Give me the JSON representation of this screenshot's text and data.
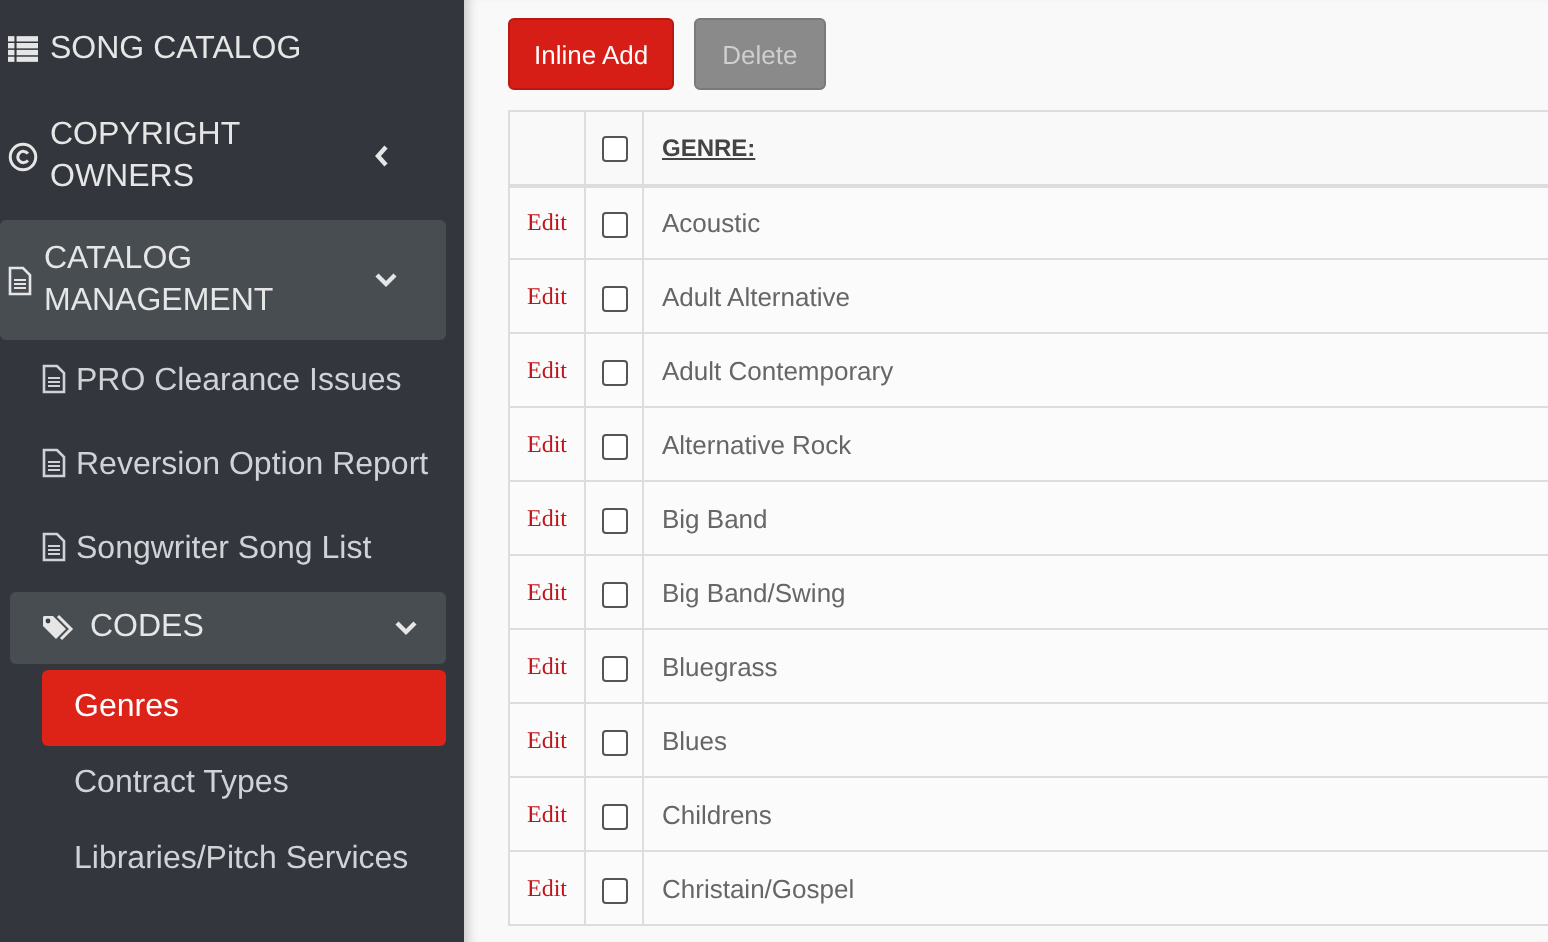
{
  "sidebar": {
    "items": [
      {
        "label": "SONG CATALOG"
      },
      {
        "label": "COPYRIGHT OWNERS",
        "expanded": false
      },
      {
        "label": "CATALOG MANAGEMENT",
        "expanded": true,
        "children": [
          {
            "label": "PRO Clearance Issues"
          },
          {
            "label": "Reversion Option Report"
          },
          {
            "label": "Songwriter Song List"
          },
          {
            "label": "CODES",
            "expanded": true,
            "children": [
              {
                "label": "Genres",
                "selected": true
              },
              {
                "label": "Contract Types",
                "selected": false
              },
              {
                "label": "Libraries/Pitch Services",
                "selected": false
              }
            ]
          }
        ]
      }
    ]
  },
  "toolbar": {
    "buttons": [
      {
        "label": "Inline Add",
        "disabled": false
      },
      {
        "label": "Delete",
        "disabled": true
      }
    ]
  },
  "table": {
    "header": {
      "column": "GENRE:",
      "checked": false
    },
    "rows": [
      {
        "action": "Edit",
        "genre": "Acoustic",
        "checked": false
      },
      {
        "action": "Edit",
        "genre": "Adult Alternative",
        "checked": false
      },
      {
        "action": "Edit",
        "genre": "Adult Contemporary",
        "checked": false
      },
      {
        "action": "Edit",
        "genre": "Alternative Rock",
        "checked": false
      },
      {
        "action": "Edit",
        "genre": "Big Band",
        "checked": false
      },
      {
        "action": "Edit",
        "genre": "Big Band/Swing",
        "checked": false
      },
      {
        "action": "Edit",
        "genre": "Bluegrass",
        "checked": false
      },
      {
        "action": "Edit",
        "genre": "Blues",
        "checked": false
      },
      {
        "action": "Edit",
        "genre": "Childrens",
        "checked": false
      },
      {
        "action": "Edit",
        "genre": "Christain/Gospel",
        "checked": false
      }
    ]
  }
}
